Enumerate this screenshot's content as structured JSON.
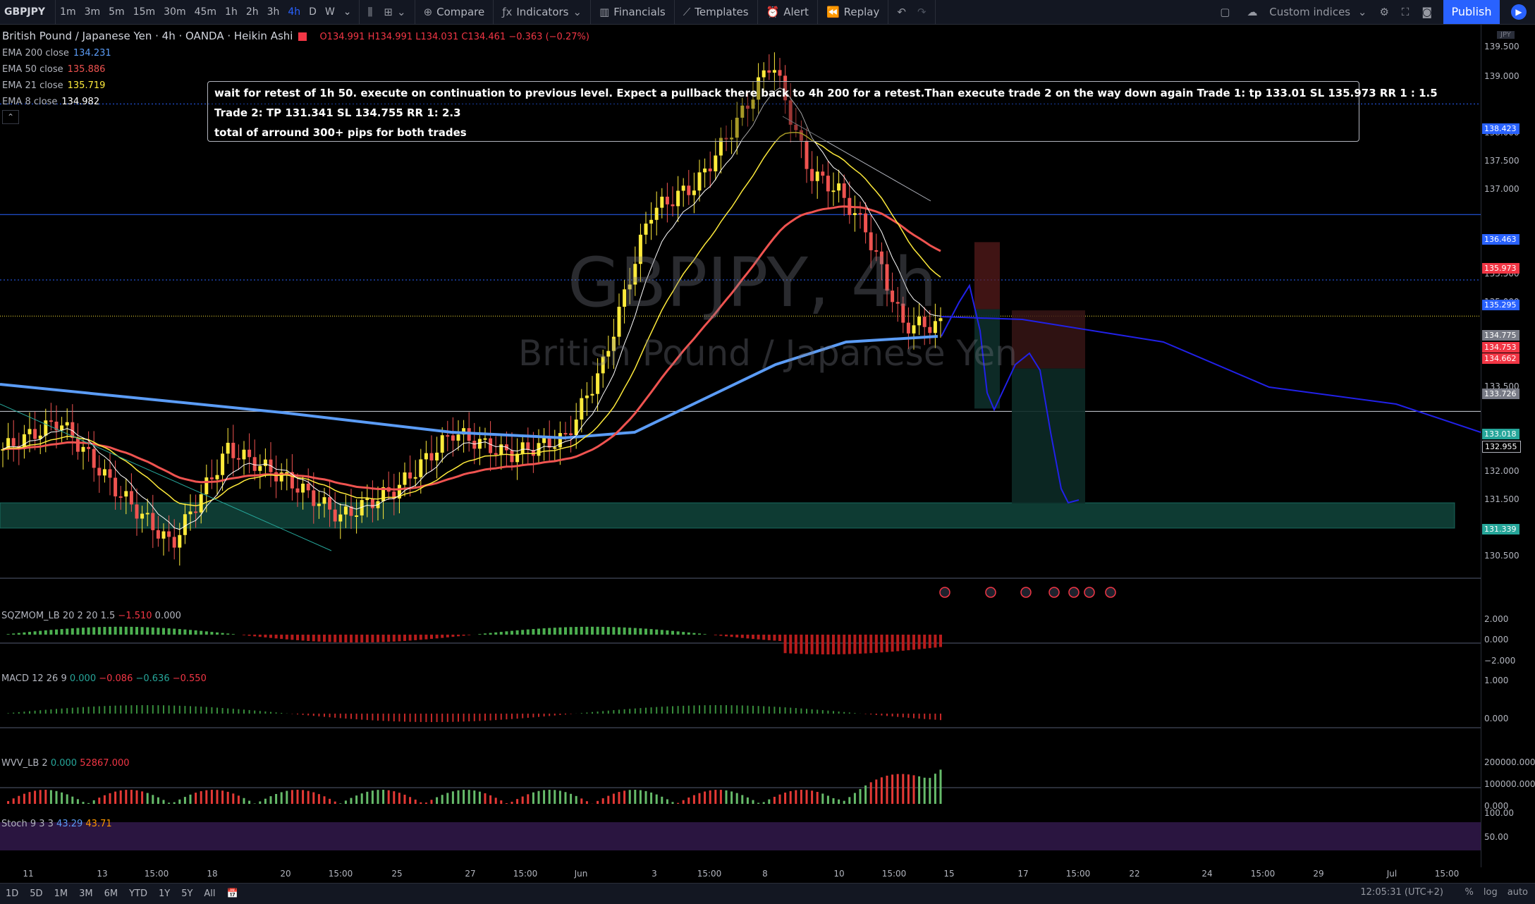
{
  "toolbar": {
    "symbol": "GBPJPY",
    "intervals": [
      "1m",
      "3m",
      "5m",
      "15m",
      "30m",
      "45m",
      "1h",
      "2h",
      "3h",
      "4h",
      "D",
      "W"
    ],
    "active_interval": "4h",
    "compare": "Compare",
    "indicators": "Indicators",
    "financials": "Financials",
    "templates": "Templates",
    "alert": "Alert",
    "replay": "Replay",
    "custom_indices": "Custom indices",
    "publish": "Publish"
  },
  "legend": {
    "title": "British Pound / Japanese Yen · 4h · OANDA · Heikin Ashi",
    "ohlc": "O134.991 H134.991 L134.031 C134.461 −0.363 (−0.27%)",
    "emas": [
      {
        "label": "EMA 200 close",
        "value": "134.231",
        "color": "#5b9cf6"
      },
      {
        "label": "EMA 50 close",
        "value": "135.886",
        "color": "#ef5350"
      },
      {
        "label": "EMA 21 close",
        "value": "135.719",
        "color": "#ffeb3b"
      },
      {
        "label": "EMA 8 close",
        "value": "134.982",
        "color": "#ffffff"
      }
    ]
  },
  "annotation": {
    "line1": "wait for retest of 1h 50. execute on continuation  to previous level. Expect a pullback there back to 4h 200 for a retest.Than execute trade 2 on the way down again Trade 1: tp 133.01 SL 135.973 RR 1 : 1.5",
    "line2": "Trade 2: TP 131.341 SL 134.755 RR 1: 2.3",
    "line3": "total of arround 300+ pips for both trades"
  },
  "watermark": {
    "symbol": "GBPJPY, 4h",
    "name": "British Pound / Japanese Yen"
  },
  "price_axis": {
    "currency": "JPY",
    "labels": [
      "139.500",
      "139.000",
      "138.000",
      "137.500",
      "137.000",
      "135.500",
      "135.000",
      "134.000",
      "133.500",
      "132.000",
      "131.500",
      "131.000",
      "130.500"
    ],
    "tags": [
      {
        "text": "138.423",
        "color": "#2962ff"
      },
      {
        "text": "136.463",
        "color": "#2962ff"
      },
      {
        "text": "135.973",
        "color": "#f23645"
      },
      {
        "text": "135.295",
        "color": "#2962ff"
      },
      {
        "text": "134.775",
        "color": "#787b86"
      },
      {
        "text": "134.753",
        "color": "#f23645"
      },
      {
        "text": "134.662",
        "color": "#f23645"
      },
      {
        "text": "133.726",
        "color": "#787b86"
      },
      {
        "text": "133.018",
        "color": "#26a69a"
      },
      {
        "text": "132.955",
        "color": "#000000"
      },
      {
        "text": "131.339",
        "color": "#26a69a"
      }
    ]
  },
  "panes": {
    "sqzmom": {
      "label": "SQZMOM_LB 20 2 20 1.5",
      "v1": "−1.510",
      "v2": "0.000",
      "axis": [
        "2.000",
        "0.000",
        "−2.000"
      ]
    },
    "macd": {
      "label": "MACD 12 26 9",
      "v1": "0.000",
      "v2": "−0.086",
      "v3": "−0.636",
      "v4": "−0.550",
      "axis": [
        "1.000",
        "0.000"
      ]
    },
    "wvv": {
      "label": "WVV_LB 2",
      "v1": "0.000",
      "v2": "52867.000",
      "axis": [
        "200000.000",
        "100000.000",
        "0.000"
      ]
    },
    "stoch": {
      "label": "Stoch 9 3 3",
      "v1": "43.29",
      "v2": "43.71",
      "axis": [
        "100.00",
        "50.00"
      ]
    }
  },
  "time_axis": [
    "11",
    "13",
    "15:00",
    "18",
    "20",
    "15:00",
    "25",
    "27",
    "15:00",
    "Jun",
    "3",
    "15:00",
    "8",
    "10",
    "15:00",
    "15",
    "17",
    "15:00",
    "22",
    "24",
    "15:00",
    "29",
    "Jul",
    "15:00"
  ],
  "bottombar": {
    "ranges": [
      "1D",
      "5D",
      "1M",
      "3M",
      "6M",
      "YTD",
      "1Y",
      "5Y",
      "All"
    ],
    "clock": "12:05:31 (UTC+2)",
    "percent": "%",
    "log": "log",
    "auto": "auto"
  },
  "colors": {
    "bull": "#ffeb3b",
    "bear": "#ef5350",
    "ema200": "#5b9cf6",
    "ema50": "#ef5350",
    "ema21": "#ffeb3b",
    "ema8": "#ffffff",
    "projection": "#2121e8",
    "zone": "#0e3b33"
  }
}
